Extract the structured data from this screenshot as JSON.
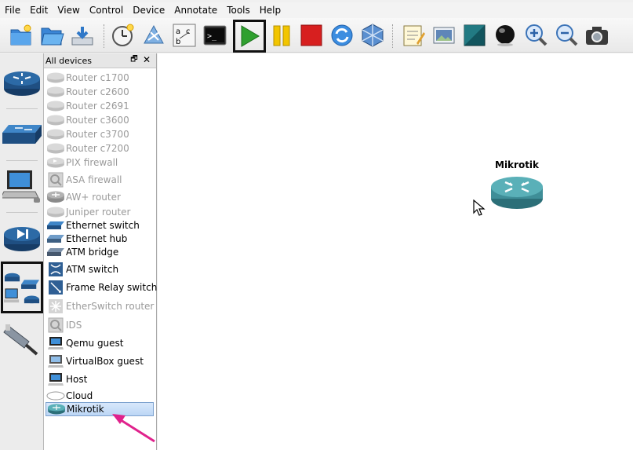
{
  "menu": [
    "File",
    "Edit",
    "View",
    "Control",
    "Device",
    "Annotate",
    "Tools",
    "Help"
  ],
  "toolbar_icons": [
    "new-project-icon",
    "open-project-icon",
    "save-project-icon",
    "snapshot-icon",
    "import-export-icon",
    "show-interface-labels-icon",
    "console-icon",
    "start-icon",
    "suspend-icon",
    "stop-icon",
    "reload-icon",
    "virtualbox-icon",
    "add-note-icon",
    "insert-picture-icon",
    "draw-rectangle-icon",
    "draw-ellipse-icon",
    "zoom-in-icon",
    "zoom-out-icon",
    "screenshot-icon"
  ],
  "device_panel": {
    "title": "All devices",
    "float_glyph": "🗗",
    "close_glyph": "✕",
    "devices": [
      {
        "label": "Router c1700",
        "icon": "router-icon",
        "enabled": false
      },
      {
        "label": "Router c2600",
        "icon": "router-icon",
        "enabled": false
      },
      {
        "label": "Router c2691",
        "icon": "router-icon",
        "enabled": false
      },
      {
        "label": "Router c3600",
        "icon": "router-icon",
        "enabled": false
      },
      {
        "label": "Router c3700",
        "icon": "router-icon",
        "enabled": false
      },
      {
        "label": "Router c7200",
        "icon": "router-icon",
        "enabled": false
      },
      {
        "label": "PIX firewall",
        "icon": "firewall-icon",
        "enabled": false
      },
      {
        "label": "ASA firewall",
        "icon": "asa-icon",
        "enabled": false
      },
      {
        "label": "AW+ router",
        "icon": "aw-router-icon",
        "enabled": false
      },
      {
        "label": "Juniper router",
        "icon": "router-icon",
        "enabled": false
      },
      {
        "label": "Ethernet switch",
        "icon": "switch-icon",
        "enabled": true
      },
      {
        "label": "Ethernet hub",
        "icon": "hub-icon",
        "enabled": true
      },
      {
        "label": "ATM bridge",
        "icon": "atm-bridge-icon",
        "enabled": true
      },
      {
        "label": "ATM switch",
        "icon": "atm-switch-icon",
        "enabled": true
      },
      {
        "label": "Frame Relay switch",
        "icon": "frame-relay-icon",
        "enabled": true
      },
      {
        "label": "EtherSwitch router",
        "icon": "etherswitch-icon",
        "enabled": false
      },
      {
        "label": "IDS",
        "icon": "ids-icon",
        "enabled": false
      },
      {
        "label": "Qemu guest",
        "icon": "qemu-icon",
        "enabled": true
      },
      {
        "label": "VirtualBox guest",
        "icon": "virtualbox-guest-icon",
        "enabled": true
      },
      {
        "label": "Host",
        "icon": "host-icon",
        "enabled": true
      },
      {
        "label": "Cloud",
        "icon": "cloud-icon",
        "enabled": true
      },
      {
        "label": "Mikrotik",
        "icon": "router-icon",
        "enabled": true,
        "selected": true
      }
    ]
  },
  "categories": [
    "router-category-icon",
    "switch-category-icon",
    "end-device-category-icon",
    "security-category-icon",
    "all-devices-category-icon",
    "cable-category-icon"
  ],
  "canvas": {
    "node_label": "Mikrotik"
  },
  "colors": {
    "router_teal": "#3f8e98",
    "router_blue": "#1f4f82",
    "arrow_pink": "#e0228c",
    "start_green": "#2fa02f",
    "stop_red": "#d71f1f",
    "pause_yellow": "#f2c500"
  }
}
